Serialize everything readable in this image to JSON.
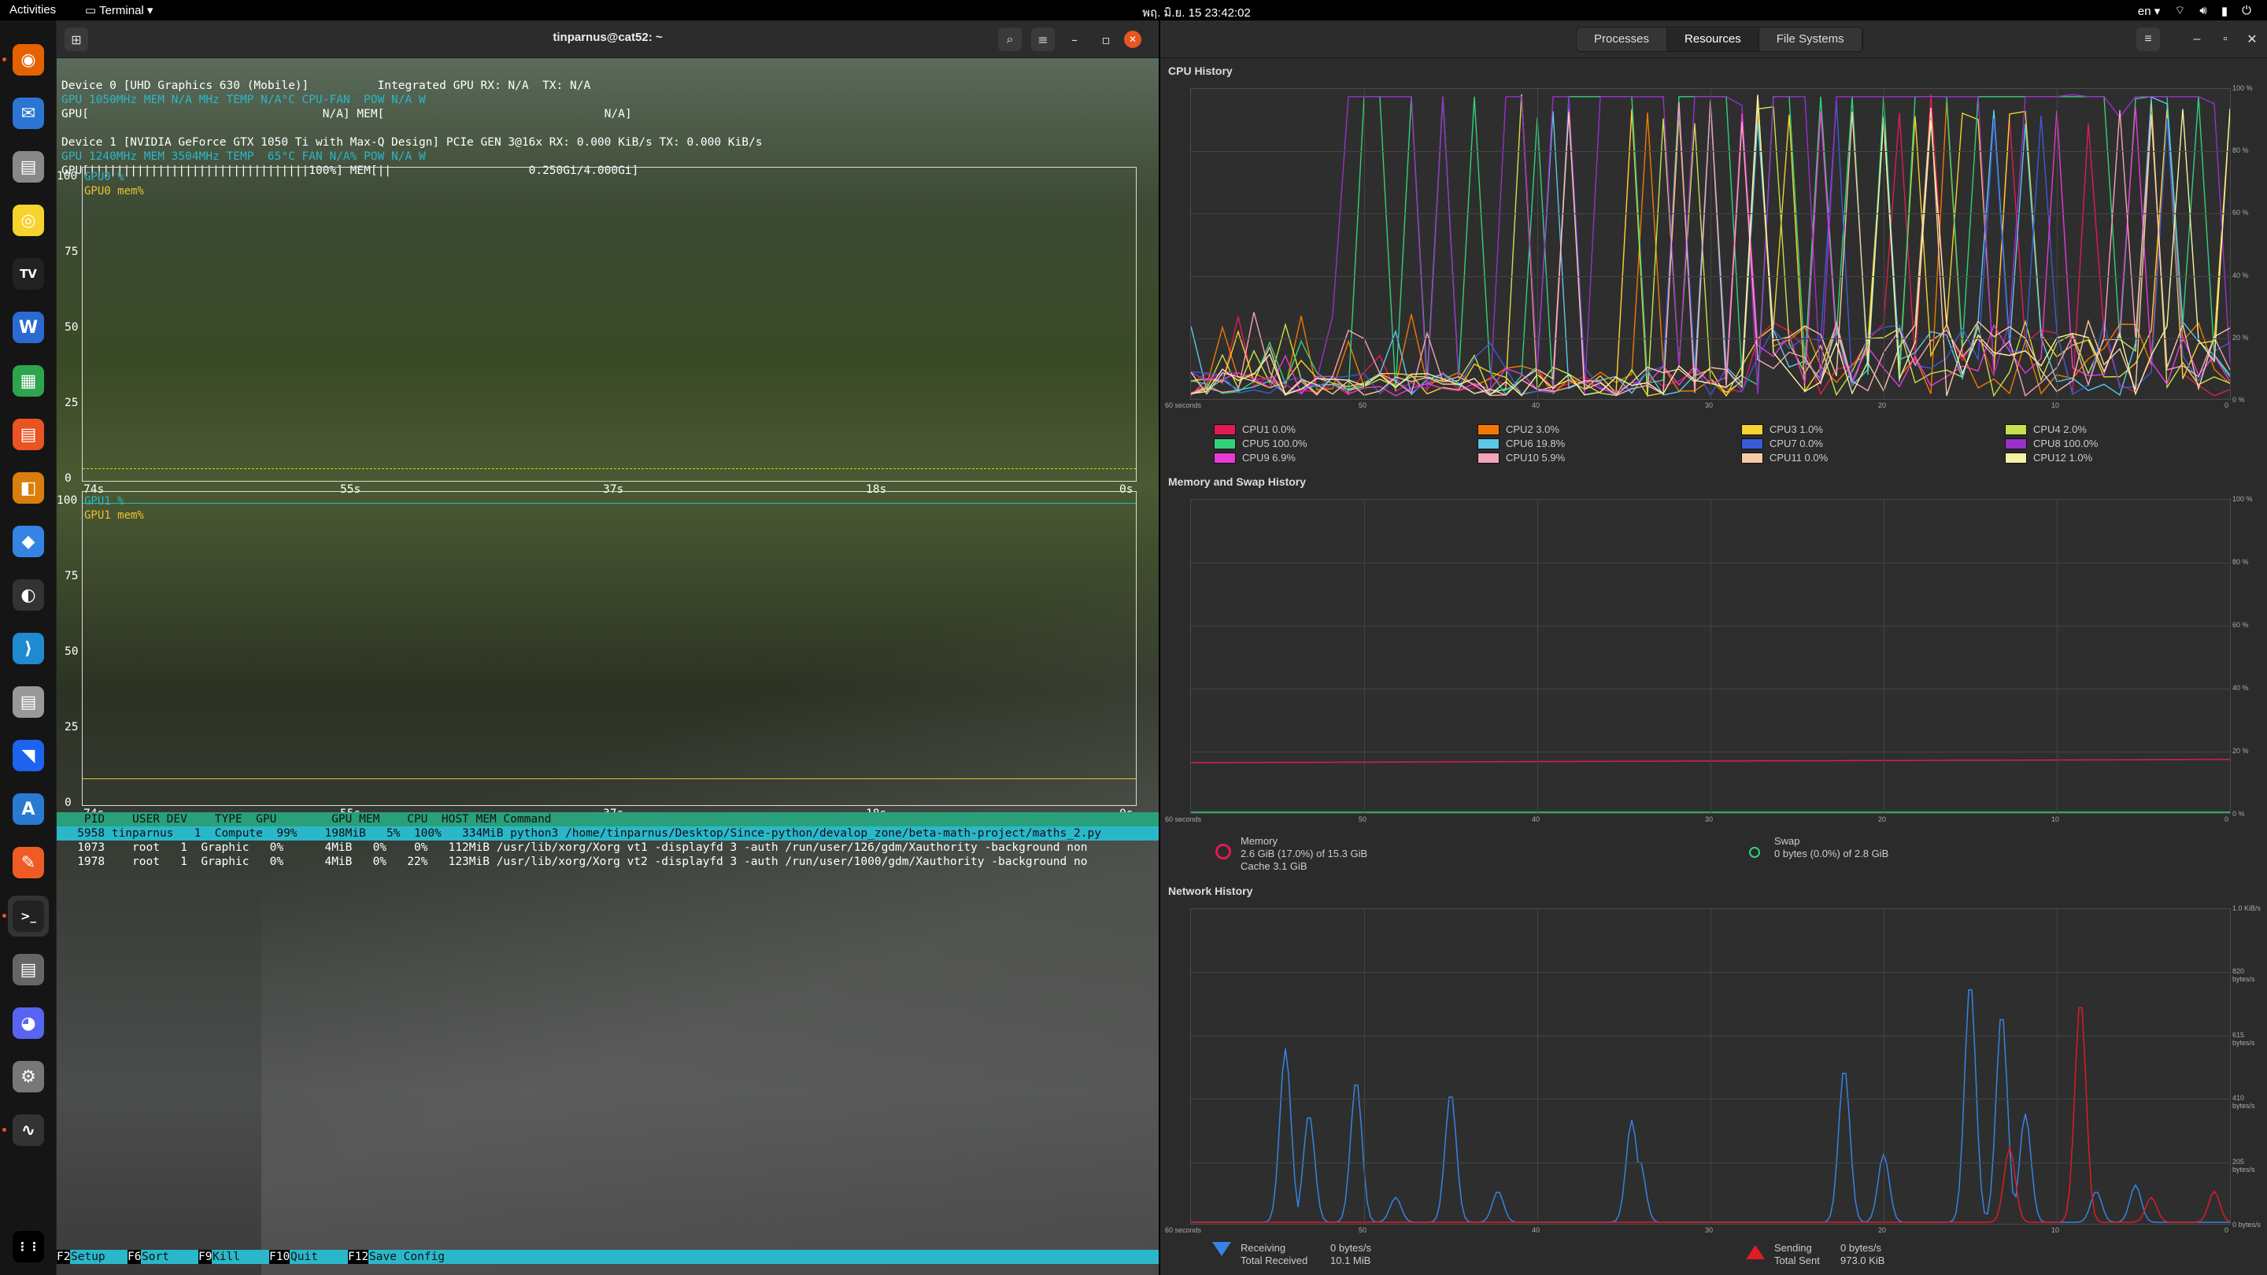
{
  "topbar": {
    "activities": "Activities",
    "app": "Terminal ▾",
    "clock": "พฤ. มิ.ย. 15  23:42:02",
    "lang": "en ▾"
  },
  "dock": {
    "items": [
      "firefox-icon",
      "thunderbird-icon",
      "files-icon",
      "rhythmbox-icon",
      "tradingview-icon",
      "writer-icon",
      "calc-icon",
      "impress-icon",
      "draw-icon",
      "software-icon",
      "obs-icon",
      "vscode-icon",
      "database-icon",
      "docker-icon",
      "appstore-icon",
      "postman-icon",
      "terminal-icon",
      "document-viewer-icon",
      "discord-icon",
      "settings-icon",
      "system-monitor-icon",
      "show-apps-icon"
    ]
  },
  "terminal": {
    "title": "tinparnus@cat52: ~",
    "device0_line1": "Device 0 [UHD Graphics 630 (Mobile)]          Integrated GPU RX: N/A  TX: N/A",
    "device0_line2": "GPU 1050MHz MEM N/A MHz TEMP N/A°C CPU-FAN  POW N/A W",
    "device0_line3": "GPU[                                  N/A] MEM[                                N/A]",
    "device1_line1": "Device 1 [NVIDIA GeForce GTX 1050 Ti with Max-Q Design] PCIe GEN 3@16x RX: 0.000 KiB/s TX: 0.000 KiB/s",
    "device1_line2": "GPU 1240MHz MEM 3504MHz TEMP  65°C FAN N/A% POW N/A W",
    "device1_line3": "GPU[||||||||||||||||||||||||||||||||100%] MEM[||                    0.250Gi/4.000Gi]",
    "graph0": {
      "legend1": "GPU0 %",
      "legend2": "GPU0 mem%",
      "yticks": [
        "100",
        "75",
        "50",
        "25",
        "0"
      ],
      "xticks": [
        "74s",
        "55s",
        "37s",
        "18s",
        "0s"
      ]
    },
    "graph1": {
      "legend1": "GPU1 %",
      "legend2": "GPU1 mem%",
      "yticks": [
        "100",
        "75",
        "50",
        "25",
        "0"
      ],
      "xticks": [
        "74s",
        "55s",
        "37s",
        "18s",
        "0s"
      ]
    },
    "proc_header": "    PID    USER DEV    TYPE  GPU        GPU MEM    CPU  HOST MEM Command",
    "proc_rows": [
      "   5958 tinparnus   1  Compute  99%    198MiB   5%  100%   334MiB python3 /home/tinparnus/Desktop/Since-python/devalop_zone/beta-math-project/maths_2.py",
      "   1073    root   1  Graphic   0%      4MiB   0%    0%   112MiB /usr/lib/xorg/Xorg vt1 -displayfd 3 -auth /run/user/126/gdm/Xauthority -background non",
      "   1978    root   1  Graphic   0%      4MiB   0%   22%   123MiB /usr/lib/xorg/Xorg vt2 -displayfd 3 -auth /run/user/1000/gdm/Xauthority -background no"
    ],
    "fkeys": [
      {
        "key": "F2",
        "label": "Setup"
      },
      {
        "key": "F6",
        "label": "Sort"
      },
      {
        "key": "F9",
        "label": "Kill"
      },
      {
        "key": "F10",
        "label": "Quit"
      },
      {
        "key": "F12",
        "label": "Save Config"
      }
    ]
  },
  "monitor": {
    "tabs": [
      "Processes",
      "Resources",
      "File Systems"
    ],
    "selected_tab": "Resources",
    "cpu_title": "CPU History",
    "mem_title": "Memory and Swap History",
    "net_title": "Network History",
    "xaxis": [
      "60 seconds",
      "50",
      "40",
      "30",
      "20",
      "10",
      "0"
    ],
    "cpu_yaxis": [
      "100 %",
      "80 %",
      "60 %",
      "40 %",
      "20 %",
      "0 %"
    ],
    "net_yaxis": [
      "1.0 KiB/s",
      "820 bytes/s",
      "615 bytes/s",
      "410 bytes/s",
      "205 bytes/s",
      "0 bytes/s"
    ],
    "cpus": [
      {
        "label": "CPU1 0.0%",
        "color": "#e01b54"
      },
      {
        "label": "CPU2 3.0%",
        "color": "#f57900"
      },
      {
        "label": "CPU3 1.0%",
        "color": "#f6d32d"
      },
      {
        "label": "CPU4 2.0%",
        "color": "#c9e04a"
      },
      {
        "label": "CPU5 100.0%",
        "color": "#33d17a"
      },
      {
        "label": "CPU6 19.8%",
        "color": "#5bc8e8"
      },
      {
        "label": "CPU7 0.0%",
        "color": "#3a5bd9"
      },
      {
        "label": "CPU8 100.0%",
        "color": "#9b2fc9"
      },
      {
        "label": "CPU9 6.9%",
        "color": "#e83ad7"
      },
      {
        "label": "CPU10 5.9%",
        "color": "#f5a3b8"
      },
      {
        "label": "CPU11 0.0%",
        "color": "#f7c9a7"
      },
      {
        "label": "CPU12 1.0%",
        "color": "#f6f3a0"
      }
    ],
    "memory": {
      "title": "Memory",
      "line1": "2.6 GiB (17.0%) of 15.3 GiB",
      "line2": "Cache 3.1 GiB",
      "color": "#e01b54"
    },
    "swap": {
      "title": "Swap",
      "line1": "0 bytes (0.0%) of 2.8 GiB",
      "color": "#33d17a"
    },
    "receiving": {
      "title": "Receiving",
      "rate": "0 bytes/s",
      "total_label": "Total Received",
      "total": "10.1 MiB",
      "color": "#3584e4"
    },
    "sending": {
      "title": "Sending",
      "rate": "0 bytes/s",
      "total_label": "Total Sent",
      "total": "973.0 KiB",
      "color": "#e01b24"
    }
  }
}
